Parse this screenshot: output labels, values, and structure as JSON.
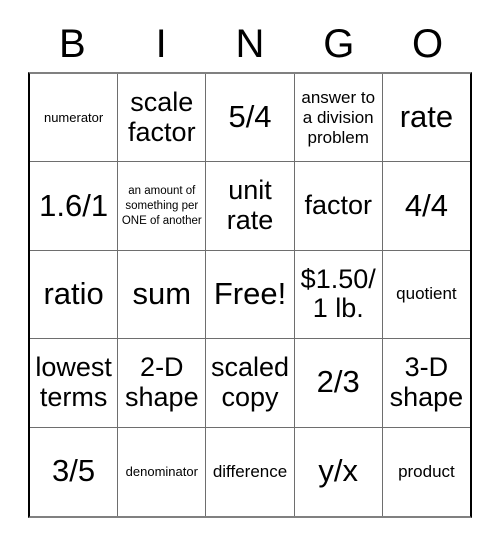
{
  "card": {
    "title_letters": [
      "B",
      "I",
      "N",
      "G",
      "O"
    ],
    "rows": [
      [
        {
          "text": "numerator",
          "size": "sm"
        },
        {
          "text": "scale factor",
          "size": "lg"
        },
        {
          "text": "5/4",
          "size": "xl"
        },
        {
          "text": "answer to a division problem",
          "size": "md"
        },
        {
          "text": "rate",
          "size": "xl"
        }
      ],
      [
        {
          "text": "1.6/1",
          "size": "xl"
        },
        {
          "text": "an amount of something per ONE of another",
          "size": "xs"
        },
        {
          "text": "unit rate",
          "size": "lg"
        },
        {
          "text": "factor",
          "size": "lg"
        },
        {
          "text": "4/4",
          "size": "xl"
        }
      ],
      [
        {
          "text": "ratio",
          "size": "xl"
        },
        {
          "text": "sum",
          "size": "xl"
        },
        {
          "text": "Free!",
          "size": "xl"
        },
        {
          "text": "$1.50/ 1 lb.",
          "size": "lg"
        },
        {
          "text": "quotient",
          "size": "md"
        }
      ],
      [
        {
          "text": "lowest terms",
          "size": "lg"
        },
        {
          "text": "2-D shape",
          "size": "lg"
        },
        {
          "text": "scaled copy",
          "size": "lg"
        },
        {
          "text": "2/3",
          "size": "xl"
        },
        {
          "text": "3-D shape",
          "size": "lg"
        }
      ],
      [
        {
          "text": "3/5",
          "size": "xl"
        },
        {
          "text": "denominator",
          "size": "sm"
        },
        {
          "text": "difference",
          "size": "md"
        },
        {
          "text": "y/x",
          "size": "xl"
        },
        {
          "text": "product",
          "size": "md"
        }
      ]
    ]
  },
  "colors": {
    "background": "#ffffff",
    "text": "#000000",
    "grid_line": "#6e6e6e",
    "grid_outer": "#000000"
  }
}
